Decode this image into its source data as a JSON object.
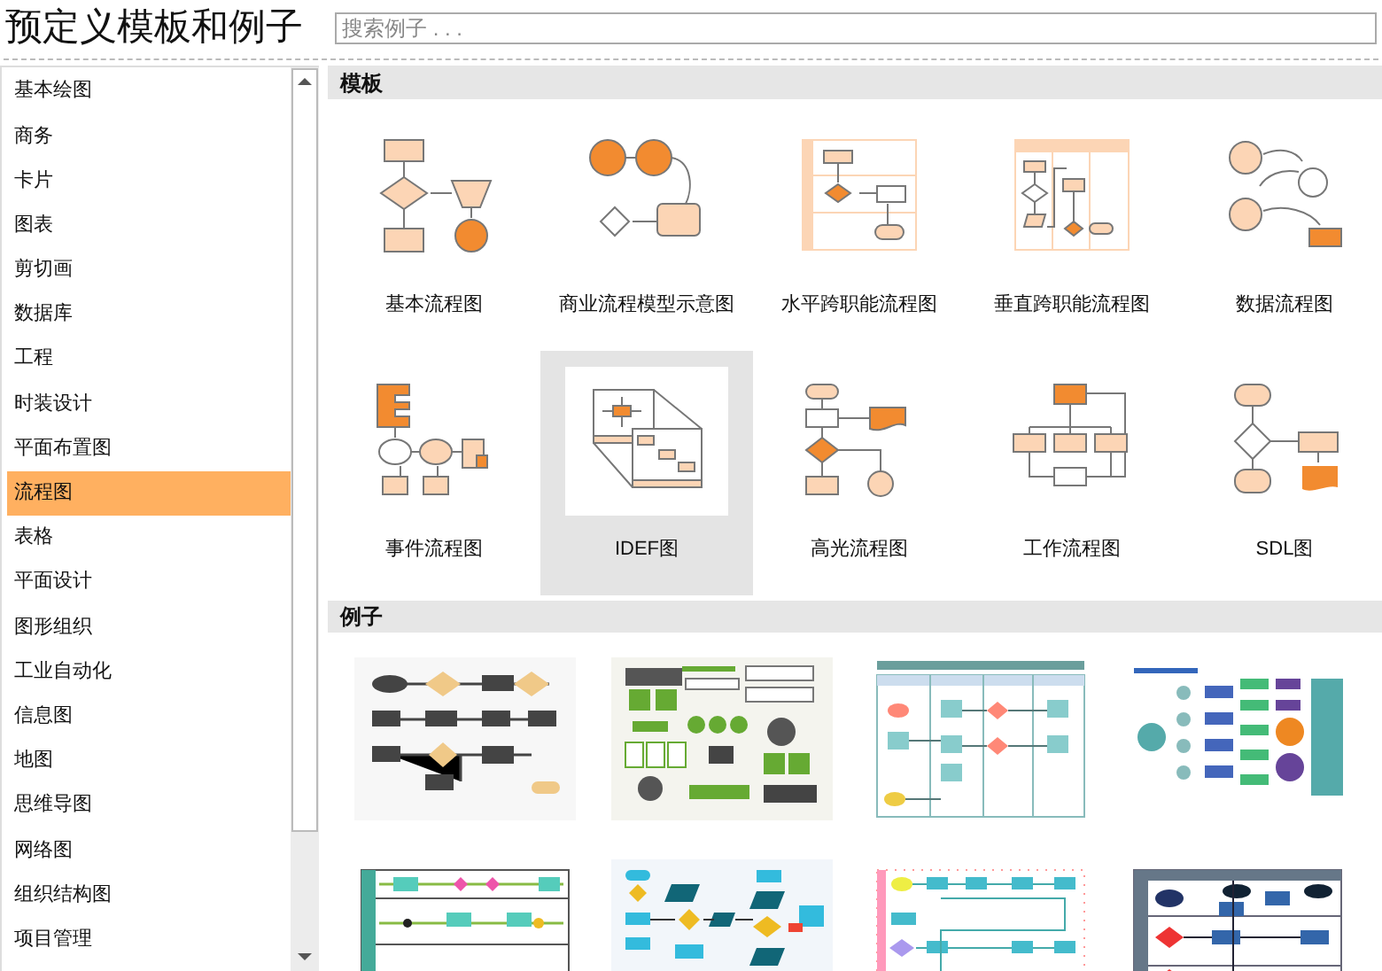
{
  "title": "预定义模板和例子",
  "search": {
    "placeholder": "搜索例子 . . ."
  },
  "sidebar": {
    "items": [
      {
        "label": "基本绘图",
        "selected": false
      },
      {
        "label": "商务",
        "selected": false
      },
      {
        "label": "卡片",
        "selected": false
      },
      {
        "label": "图表",
        "selected": false
      },
      {
        "label": "剪切画",
        "selected": false
      },
      {
        "label": "数据库",
        "selected": false
      },
      {
        "label": "工程",
        "selected": false
      },
      {
        "label": "时装设计",
        "selected": false
      },
      {
        "label": "平面布置图",
        "selected": false
      },
      {
        "label": "流程图",
        "selected": true
      },
      {
        "label": "表格",
        "selected": false
      },
      {
        "label": "平面设计",
        "selected": false
      },
      {
        "label": "图形组织",
        "selected": false
      },
      {
        "label": "工业自动化",
        "selected": false
      },
      {
        "label": "信息图",
        "selected": false
      },
      {
        "label": "地图",
        "selected": false
      },
      {
        "label": "思维导图",
        "selected": false
      },
      {
        "label": "网络图",
        "selected": false
      },
      {
        "label": "组织结构图",
        "selected": false
      },
      {
        "label": "项目管理",
        "selected": false
      }
    ]
  },
  "templates": {
    "heading": "模板",
    "items": [
      {
        "label": "基本流程图",
        "kind": "basic",
        "selected": false
      },
      {
        "label": "商业流程模型示意图",
        "kind": "business",
        "selected": false
      },
      {
        "label": "水平跨职能流程图",
        "kind": "hlane",
        "selected": false
      },
      {
        "label": "垂直跨职能流程图",
        "kind": "vlane",
        "selected": false
      },
      {
        "label": "数据流程图",
        "kind": "data",
        "selected": false
      },
      {
        "label": "事件流程图",
        "kind": "event",
        "selected": false
      },
      {
        "label": "IDEF图",
        "kind": "idef",
        "selected": true
      },
      {
        "label": "高光流程图",
        "kind": "highlight",
        "selected": false
      },
      {
        "label": "工作流程图",
        "kind": "work",
        "selected": false
      },
      {
        "label": "SDL图",
        "kind": "sdl",
        "selected": false
      }
    ]
  },
  "examples": {
    "heading": "例子",
    "items": [
      {
        "kind": "dark"
      },
      {
        "kind": "green"
      },
      {
        "kind": "swimlane"
      },
      {
        "kind": "tree"
      },
      {
        "kind": "process"
      },
      {
        "kind": "blue"
      },
      {
        "kind": "dotted"
      },
      {
        "kind": "navy"
      }
    ]
  }
}
